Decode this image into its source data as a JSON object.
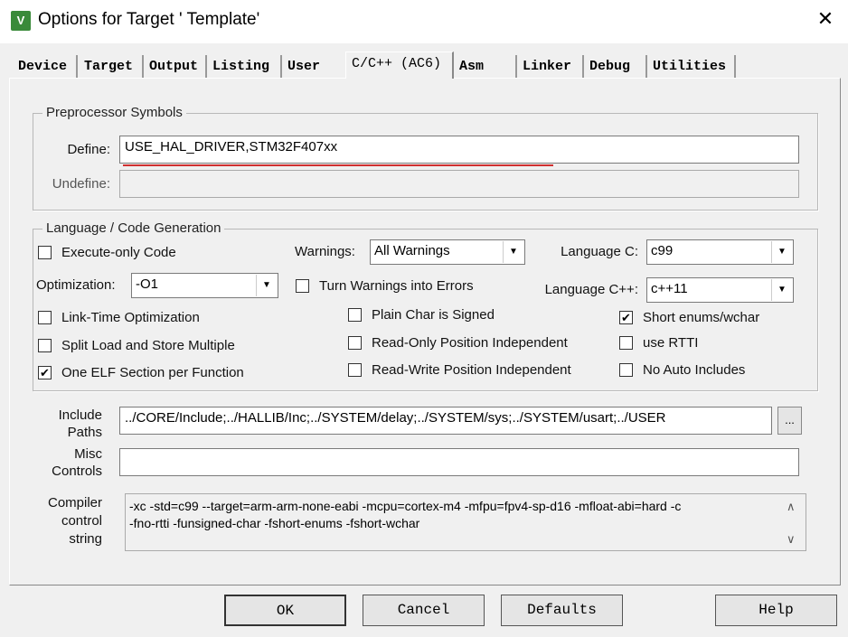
{
  "window": {
    "title": "Options for Target ' Template'",
    "icon": "keil-uvision-icon",
    "close": "✕"
  },
  "tabs": [
    {
      "label": "Device"
    },
    {
      "label": "Target"
    },
    {
      "label": "Output"
    },
    {
      "label": "Listing"
    },
    {
      "label": "User"
    },
    {
      "label": "C/C++ (AC6)",
      "selected": true
    },
    {
      "label": "Asm"
    },
    {
      "label": "Linker"
    },
    {
      "label": "Debug"
    },
    {
      "label": "Utilities"
    }
  ],
  "preprocessor": {
    "title": "Preprocessor Symbols",
    "define_label": "Define:",
    "define_value": "USE_HAL_DRIVER,STM32F407xx",
    "undefine_label": "Undefine:",
    "undefine_value": ""
  },
  "language": {
    "title": "Language / Code Generation",
    "execute_only": {
      "label": "Execute-only Code",
      "checked": false
    },
    "optimization_label": "Optimization:",
    "optimization_value": "-O1",
    "link_time": {
      "label": "Link-Time Optimization",
      "checked": false
    },
    "split_load": {
      "label": "Split Load and Store Multiple",
      "checked": false
    },
    "one_elf": {
      "label": "One ELF Section per Function",
      "checked": true
    },
    "warnings_label": "Warnings:",
    "warnings_value": "All Warnings",
    "turn_warnings": {
      "label": "Turn Warnings into Errors",
      "checked": false
    },
    "plain_char": {
      "label": "Plain Char is Signed",
      "checked": false
    },
    "ro_pi": {
      "label": "Read-Only Position Independent",
      "checked": false
    },
    "rw_pi": {
      "label": "Read-Write Position Independent",
      "checked": false
    },
    "language_c_label": "Language C:",
    "language_c_value": "c99",
    "language_cpp_label": "Language C++:",
    "language_cpp_value": "c++11",
    "short_enums": {
      "label": "Short enums/wchar",
      "checked": true
    },
    "use_rtti": {
      "label": "use RTTI",
      "checked": false
    },
    "no_auto": {
      "label": "No Auto Includes",
      "checked": false
    }
  },
  "include": {
    "label1": "Include",
    "label2": "Paths",
    "value": "../CORE/Include;../HALLIB/Inc;../SYSTEM/delay;../SYSTEM/sys;../SYSTEM/usart;../USER",
    "browse": "..."
  },
  "misc": {
    "label1": "Misc",
    "label2": "Controls",
    "value": ""
  },
  "compiler": {
    "label1": "Compiler",
    "label2": "control",
    "label3": "string",
    "line1": "-xc -std=c99 --target=arm-arm-none-eabi -mcpu=cortex-m4 -mfpu=fpv4-sp-d16 -mfloat-abi=hard -c",
    "line2": "-fno-rtti -funsigned-char -fshort-enums -fshort-wchar"
  },
  "buttons": {
    "ok": "OK",
    "cancel": "Cancel",
    "defaults": "Defaults",
    "help": "Help"
  },
  "colors": {
    "annotation_underline": "#d03030"
  }
}
